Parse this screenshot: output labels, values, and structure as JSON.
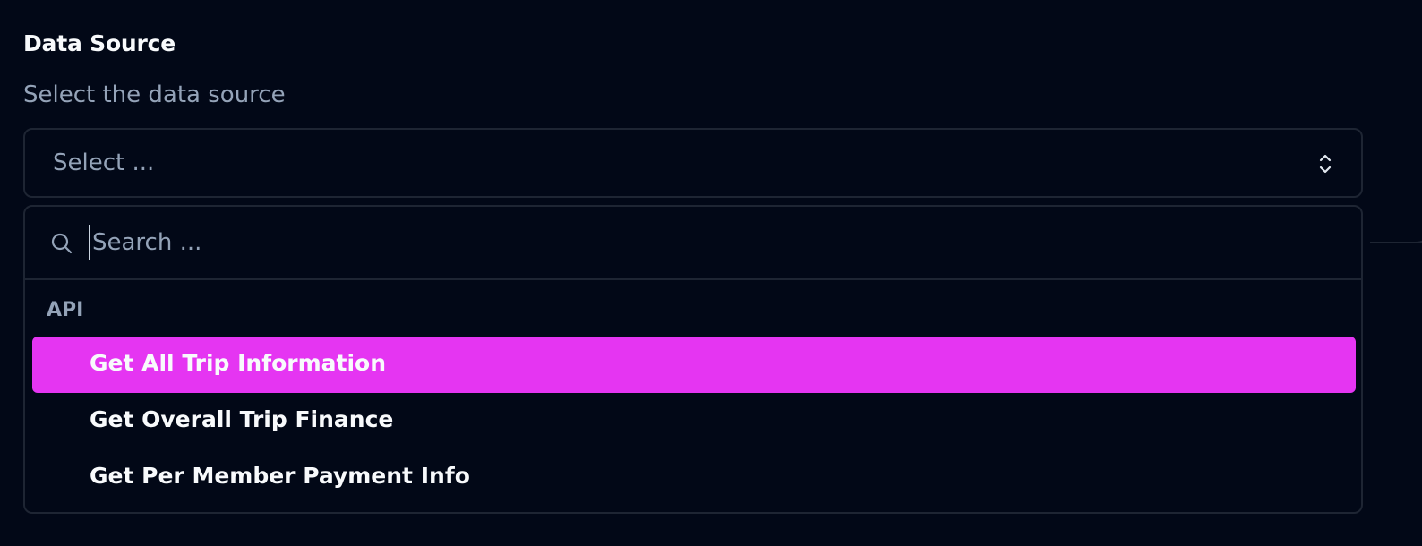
{
  "field": {
    "title": "Data Source",
    "description": "Select the data source"
  },
  "select": {
    "placeholder": "Select ...",
    "chevron_icon": "chevrons-up-down-icon"
  },
  "dropdown": {
    "search": {
      "placeholder": "Search ...",
      "value": "",
      "icon": "search-icon"
    },
    "groups": [
      {
        "label": "API",
        "options": [
          {
            "label": "Get All Trip Information",
            "highlighted": true
          },
          {
            "label": "Get Overall Trip Finance",
            "highlighted": false
          },
          {
            "label": "Get Per Member Payment Info",
            "highlighted": false
          }
        ]
      }
    ]
  },
  "colors": {
    "background": "#020817",
    "border": "#1e2533",
    "highlight": "#e535f2",
    "muted_text": "#94a3b8",
    "text": "#f8fafc"
  }
}
